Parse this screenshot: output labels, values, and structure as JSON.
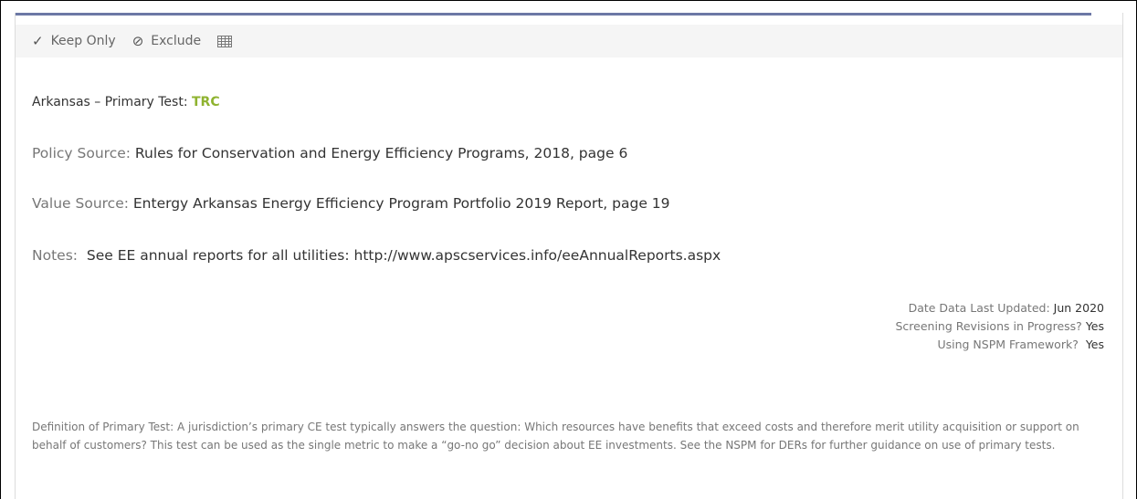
{
  "toolbar": {
    "keep_only_label": "Keep Only",
    "exclude_label": "Exclude"
  },
  "header": {
    "title_prefix": "Arkansas – Primary Test: ",
    "test_name": "TRC"
  },
  "details": {
    "policy_source_label": "Policy Source:",
    "policy_source_value": "Rules for Conservation and Energy Efficiency Programs, 2018, page 6",
    "value_source_label": "Value Source:",
    "value_source_value": "Entergy Arkansas Energy Efficiency Program Portfolio 2019 Report, page 19",
    "notes_label": "Notes:",
    "notes_value": "See EE annual reports for all utilities: http://www.apscservices.info/eeAnnualReports.aspx"
  },
  "meta": {
    "date_label": "Date Data Last Updated:",
    "date_value": "Jun 2020",
    "revisions_label": "Screening Revisions in Progress?",
    "revisions_value": "Yes",
    "nspm_label": "Using NSPM Framework?",
    "nspm_value": "Yes"
  },
  "definition": "Definition of Primary Test: A jurisdiction’s primary CE test typically answers the question: Which resources have benefits that exceed costs and therefore merit utility acquisition or support on behalf of customers? This test can be used as the single metric to make a “go-no go” decision about EE investments. See the NSPM for DERs for further guidance on use of primary tests.",
  "colors": {
    "accent_bar": "#6c78a5",
    "test_name": "#8fb330"
  }
}
